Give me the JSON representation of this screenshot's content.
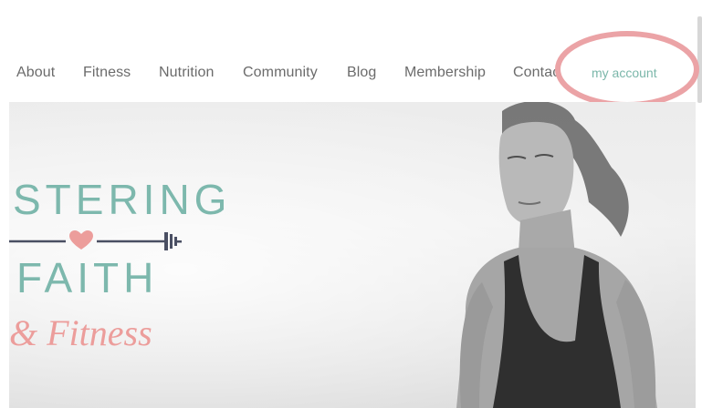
{
  "nav": {
    "items": [
      {
        "label": "About"
      },
      {
        "label": "Fitness"
      },
      {
        "label": "Nutrition"
      },
      {
        "label": "Community"
      },
      {
        "label": "Blog"
      },
      {
        "label": "Membership"
      },
      {
        "label": "Contac"
      }
    ],
    "account_label": "my account"
  },
  "hero": {
    "logo_line1": "STERING",
    "logo_line2": "FAITH",
    "logo_script": "& Fitness"
  },
  "colors": {
    "brand_teal": "#7db8ad",
    "brand_pink": "#ec9d9b",
    "nav_text": "#6b6b6b",
    "highlight": "#eba3a6",
    "logo_bar": "#4a4f63"
  },
  "icons": {
    "heart": "heart-icon",
    "barbell": "barbell-icon"
  }
}
